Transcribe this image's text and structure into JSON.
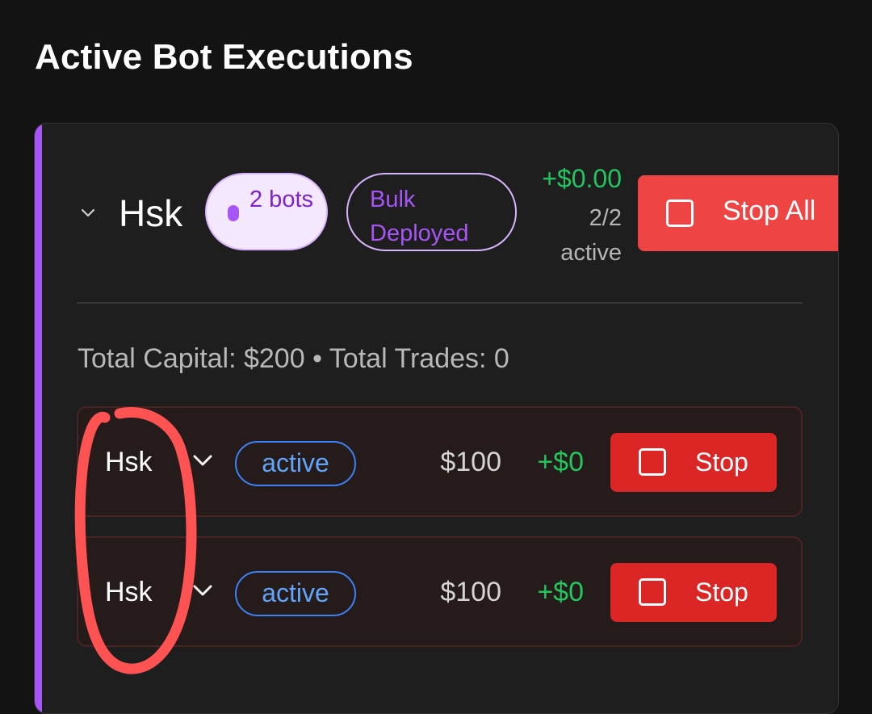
{
  "page": {
    "title": "Active Bot Executions"
  },
  "group": {
    "name": "Hsk",
    "bots_badge": "2 bots",
    "deploy_badge": "Bulk Deployed",
    "total_pnl": "+$0.00",
    "active_count": "2/2 active",
    "stop_all_label": "Stop All",
    "summary": "Total Capital: $200 • Total Trades: 0",
    "accent_color": "#a855f7"
  },
  "bots": [
    {
      "name": "Hsk",
      "status": "active",
      "capital": "$100",
      "pnl": "+$0",
      "stop_label": "Stop"
    },
    {
      "name": "Hsk",
      "status": "active",
      "capital": "$100",
      "pnl": "+$0",
      "stop_label": "Stop"
    }
  ],
  "colors": {
    "stop_all": "#ef4444",
    "stop": "#dc2626",
    "profit": "#22c55e",
    "status_active": "#60a5fa",
    "annotation": "#ff5252"
  }
}
